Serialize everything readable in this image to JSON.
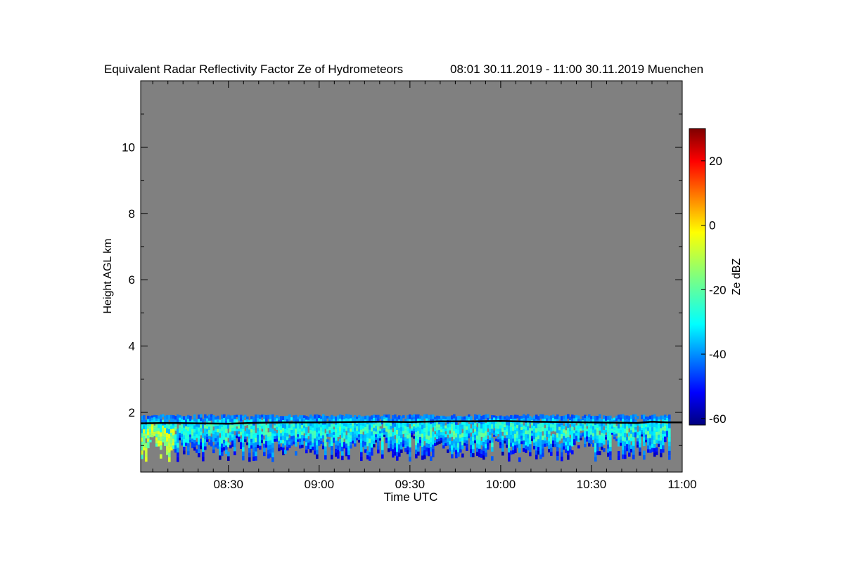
{
  "chart_data": {
    "type": "heatmap",
    "title": "Equivalent Radar Reflectivity Factor Ze of Hydrometeors",
    "period": "08:01 30.11.2019 - 11:00 30.11.2019 Muenchen",
    "xlabel": "Time UTC",
    "ylabel": "Height AGL km",
    "x_ticks": [
      "08:30",
      "09:00",
      "09:30",
      "10:00",
      "10:30",
      "11:00"
    ],
    "x_tick_minutes": [
      510,
      540,
      570,
      600,
      630,
      660
    ],
    "xlim_minutes": [
      481,
      660
    ],
    "y_ticks": [
      2,
      4,
      6,
      8,
      10
    ],
    "ylim": [
      0.2,
      12
    ],
    "colorbar": {
      "label": "Ze dBZ",
      "ticks": [
        20,
        0,
        -20,
        -40,
        -60
      ],
      "range": [
        -62,
        30
      ],
      "colormap": "jet"
    },
    "background_color": "#808080",
    "echo_layer": {
      "description_values": "low cloud layer echoes",
      "top_km": 1.95,
      "base_km_range": [
        0.5,
        1.3
      ],
      "typical_dbz": [
        -45,
        -25
      ],
      "max_dbz_near_start": -5
    },
    "black_line": {
      "height_km_samples": [
        [
          481,
          1.67
        ],
        [
          490,
          1.68
        ],
        [
          500,
          1.67
        ],
        [
          510,
          1.66
        ],
        [
          520,
          1.69
        ],
        [
          530,
          1.7
        ],
        [
          540,
          1.7
        ],
        [
          550,
          1.71
        ],
        [
          560,
          1.72
        ],
        [
          570,
          1.71
        ],
        [
          580,
          1.73
        ],
        [
          590,
          1.73
        ],
        [
          600,
          1.74
        ],
        [
          610,
          1.72
        ],
        [
          620,
          1.71
        ],
        [
          630,
          1.7
        ],
        [
          640,
          1.69
        ],
        [
          645,
          1.68
        ],
        [
          650,
          1.72
        ],
        [
          655,
          1.7
        ],
        [
          660,
          1.7
        ]
      ]
    }
  }
}
